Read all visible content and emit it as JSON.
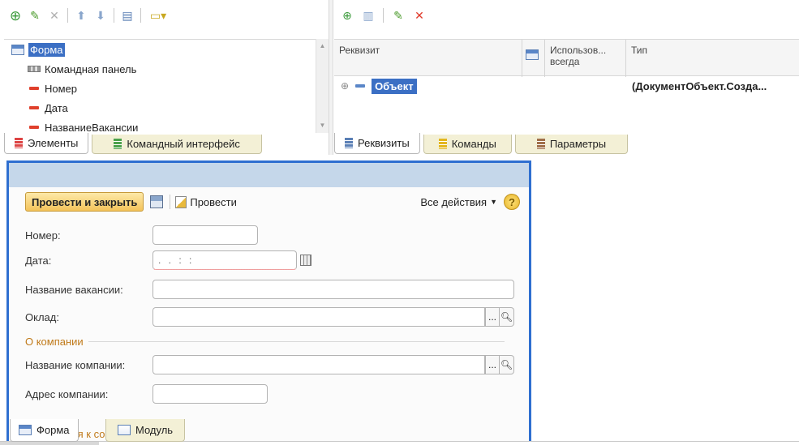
{
  "elements_panel": {
    "tree": [
      {
        "label": "Форма",
        "icon": "form-icon",
        "selected": true
      },
      {
        "label": "Командная панель",
        "icon": "command-panel-icon"
      },
      {
        "label": "Номер",
        "icon": "field-icon"
      },
      {
        "label": "Дата",
        "icon": "field-icon"
      },
      {
        "label": "НазваниеВакансии",
        "icon": "field-icon"
      }
    ],
    "tabs": [
      {
        "label": "Элементы",
        "active": true
      },
      {
        "label": "Командный интерфейс",
        "active": false
      }
    ]
  },
  "attributes_panel": {
    "columns": [
      "Реквизит",
      "Использов... всегда",
      "Тип"
    ],
    "rows": [
      {
        "name": "Объект",
        "type": "(ДокументОбъект.Созда..."
      }
    ],
    "tabs": [
      {
        "label": "Реквизиты",
        "active": true
      },
      {
        "label": "Команды",
        "active": false
      },
      {
        "label": "Параметры",
        "active": false
      }
    ]
  },
  "form_preview": {
    "primary_button": "Провести и закрыть",
    "post_button": "Провести",
    "all_actions": "Все действия",
    "help": "?",
    "fields": [
      {
        "label": "Номер:",
        "value": ""
      },
      {
        "label": "Дата:",
        "value": ". .   : :"
      },
      {
        "label": "Название вакансии:",
        "value": ""
      },
      {
        "label": "Оклад:",
        "value": ""
      },
      {
        "label": "Название компании:",
        "value": ""
      },
      {
        "label": "Адрес компании:",
        "value": ""
      }
    ],
    "groups": [
      "О компании",
      "Требования к соискателю"
    ]
  },
  "bottom_tabs": [
    {
      "label": "Форма",
      "active": true
    },
    {
      "label": "Модуль",
      "active": false
    }
  ],
  "colors": {
    "selection": "#3b6fc4",
    "form_border": "#2f6fd0",
    "group_title": "#c07a1a",
    "primary_button": "#f4c35a"
  }
}
